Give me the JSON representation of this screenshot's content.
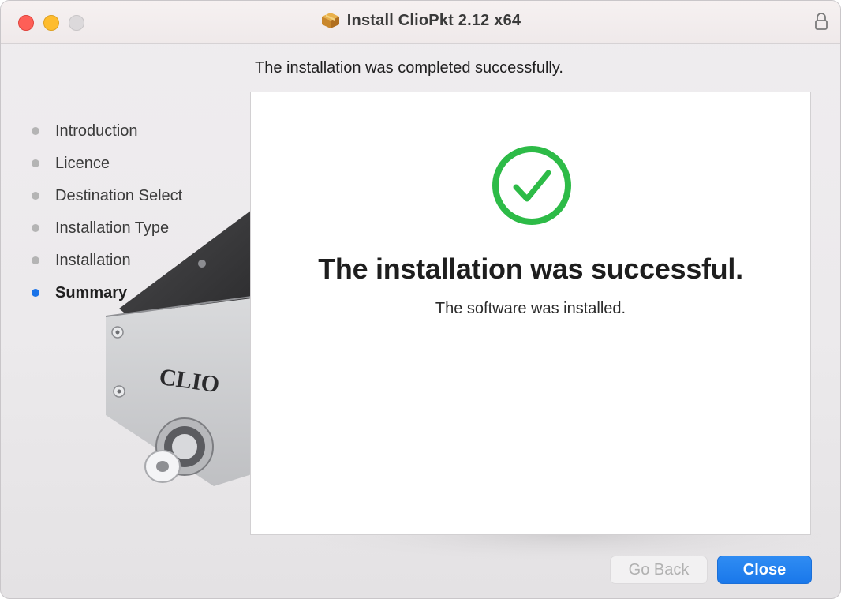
{
  "window": {
    "title": "Install ClioPkt 2.12 x64"
  },
  "sidebar": {
    "steps": [
      {
        "label": "Introduction",
        "state": "done"
      },
      {
        "label": "Licence",
        "state": "done"
      },
      {
        "label": "Destination Select",
        "state": "done"
      },
      {
        "label": "Installation Type",
        "state": "done"
      },
      {
        "label": "Installation",
        "state": "done"
      },
      {
        "label": "Summary",
        "state": "active"
      }
    ]
  },
  "content": {
    "header": "The installation was completed successfully.",
    "title": "The installation was successful.",
    "subtitle": "The software was installed."
  },
  "background": {
    "device_label": "CLIO"
  },
  "buttons": {
    "back": "Go Back",
    "close": "Close"
  },
  "icons": {
    "app": "package-icon",
    "lock": "lock-icon",
    "success": "checkmark-circle-icon"
  },
  "colors": {
    "accent": "#1a78ea",
    "success": "#2dbb47",
    "active_step": "#1a73e8",
    "inactive_step": "#b4b4b4"
  }
}
